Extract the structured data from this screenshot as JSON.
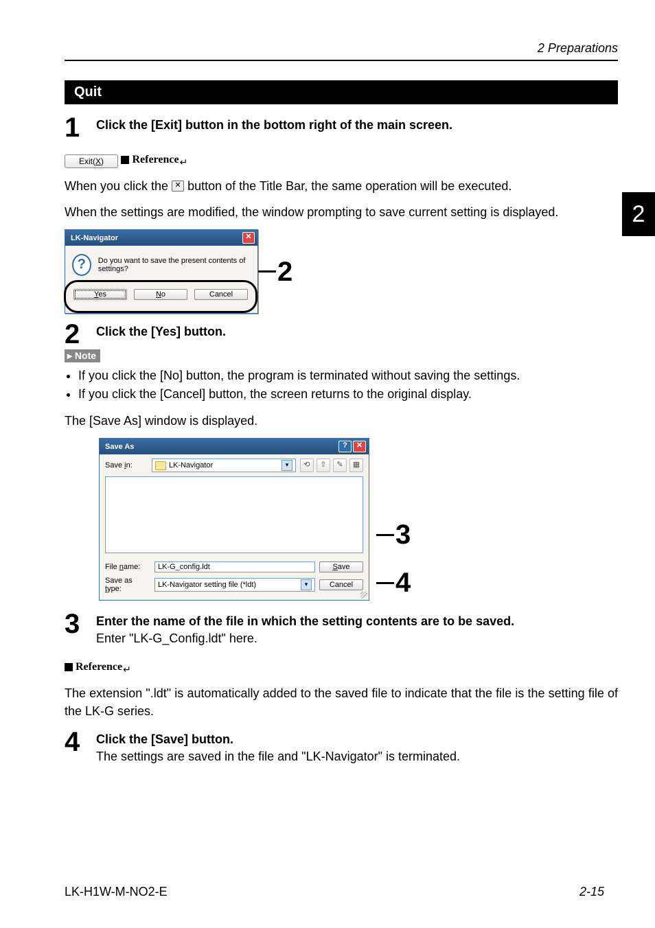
{
  "header": {
    "chapter": "2  Preparations"
  },
  "side_tab": "2",
  "section": {
    "title": "Quit"
  },
  "steps": {
    "s1": {
      "num": "1",
      "title": "Click the [Exit] button in the bottom right of the main screen."
    },
    "s2": {
      "num": "2",
      "title": "Click the [Yes] button."
    },
    "s3": {
      "num": "3",
      "title": "Enter the name of the file in which the setting contents are to be saved.",
      "sub": "Enter \"LK-G_Config.ldt\" here."
    },
    "s4": {
      "num": "4",
      "title": "Click the [Save] button.",
      "sub": "The settings are saved in the file and \"LK-Navigator\" is terminated."
    }
  },
  "exit_button": {
    "label_pre": "Exit(",
    "label_u": "X",
    "label_post": ")"
  },
  "reference_label": "Reference",
  "ref1_pre": "When you click the ",
  "ref1_post": " button of the Title Bar, the same operation will be executed.",
  "body_settings_modified": "When the settings are modified, the window prompting to save current setting is displayed.",
  "prompt_dialog": {
    "title": "LK-Navigator",
    "message": "Do you want to save the present contents of settings?",
    "yes_u": "Y",
    "yes_post": "es",
    "no_u": "N",
    "no_post": "o",
    "cancel": "Cancel"
  },
  "callout_prompt_num": "2",
  "note_label": "▸ Note",
  "note_items": [
    "If you click the [No] button, the program is terminated without saving the settings.",
    "If you click the [Cancel] button, the screen returns to the original display."
  ],
  "body_saveas_displayed": "The [Save As] window is displayed.",
  "saveas": {
    "title": "Save As",
    "save_in_pre": "Save ",
    "save_in_u": "i",
    "save_in_post": "n:",
    "folder": "LK-Navigator",
    "file_name_pre": "File ",
    "file_name_u": "n",
    "file_name_post": "ame:",
    "file_name_value": "LK-G_config.ldt",
    "type_pre": "Save as ",
    "type_u": "t",
    "type_post": "ype:",
    "type_value": "LK-Navigator setting file (*ldt)",
    "save_u": "S",
    "save_post": "ave",
    "cancel": "Cancel"
  },
  "callout_saveas_3": "3",
  "callout_saveas_4": "4",
  "ref2_text": "The extension \".ldt\" is automatically added to the saved file to indicate that the file is the setting file of the LK-G series.",
  "footer": {
    "left": "LK-H1W-M-NO2-E",
    "right": "2-15"
  },
  "icons": {
    "close_x": "✕",
    "help_q": "?",
    "dd": "▾",
    "back": "⟲",
    "up": "⇧",
    "new": "✎",
    "view": "▦"
  }
}
